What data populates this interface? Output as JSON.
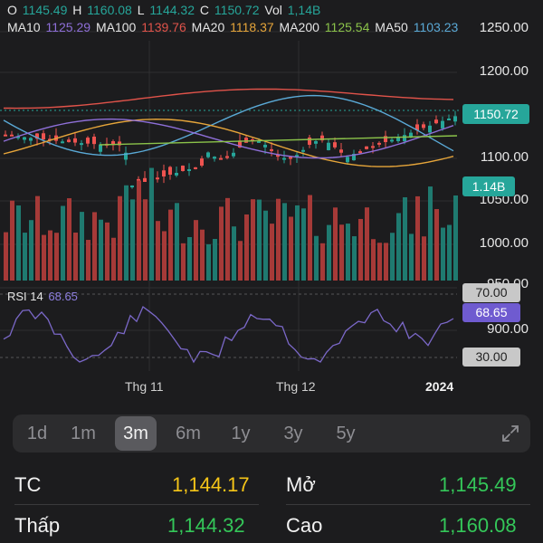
{
  "ohlc": {
    "o_label": "O",
    "o": "1145.49",
    "h_label": "H",
    "h": "1160.08",
    "l_label": "L",
    "l": "1144.32",
    "c_label": "C",
    "c": "1150.72",
    "vol_label": "Vol",
    "vol": "1,14B"
  },
  "ma": {
    "ma10_label": "MA10",
    "ma10": "1125.29",
    "ma100_label": "MA100",
    "ma100": "1139.76",
    "ma20_label": "MA20",
    "ma20": "1118.37",
    "ma200_label": "MA200",
    "ma200": "1125.54",
    "ma50_label": "MA50",
    "ma50": "1103.23"
  },
  "rsi": {
    "label": "RSI 14",
    "value": "68.65"
  },
  "price_tag": "1150.72",
  "vol_tag": "1.14B",
  "y_labels": [
    "1250.00",
    "1200.00",
    "1100.00",
    "1050.00",
    "1000.00",
    "950.00",
    "900.00"
  ],
  "rsi_levels": [
    "70.00",
    "30.00"
  ],
  "x_labels": [
    "Thg 11",
    "Thg 12",
    "2024"
  ],
  "ranges": [
    "1d",
    "1m",
    "3m",
    "6m",
    "1y",
    "3y",
    "5y"
  ],
  "active_range": "3m",
  "stats": {
    "tc_label": "TC",
    "tc_value": "1,144.17",
    "mo_label": "Mở",
    "mo_value": "1,145.49",
    "thap_label": "Thấp",
    "thap_value": "1,144.32",
    "cao_label": "Cao",
    "cao_value": "1,160.08"
  },
  "colors": {
    "up": "#26a69a",
    "down": "#ef5350",
    "ma10": "#8e6fd8",
    "ma100": "#e0534a",
    "ma20": "#e6a53a",
    "ma200": "#8bc34a",
    "ma50": "#5aa9d6",
    "rsi": "#7b68c9",
    "tc": "#f5c518",
    "green": "#34c759"
  }
}
